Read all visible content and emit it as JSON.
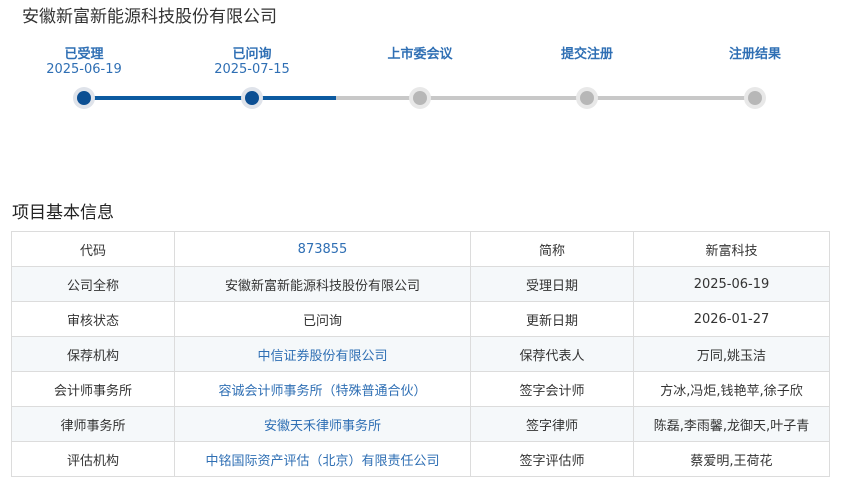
{
  "company_title": "安徽新富新能源科技股份有限公司",
  "progress": {
    "steps": [
      {
        "label": "已受理",
        "date": "2025-06-19",
        "status": "done"
      },
      {
        "label": "已问询",
        "date": "2025-07-15",
        "status": "done"
      },
      {
        "label": "上市委会议",
        "date": "",
        "status": "pending"
      },
      {
        "label": "提交注册",
        "date": "",
        "status": "pending"
      },
      {
        "label": "注册结果",
        "date": "",
        "status": "pending"
      }
    ],
    "colors": {
      "done": "#0c4f93",
      "pending": "#b7b7b7",
      "label": "#2f6fb4"
    }
  },
  "info_section": {
    "title": "项目基本信息",
    "rows": [
      {
        "l1": "代码",
        "v1": "873855",
        "v1_link": true,
        "l2": "简称",
        "v2": "新富科技"
      },
      {
        "l1": "公司全称",
        "v1": "安徽新富新能源科技股份有限公司",
        "v1_link": false,
        "l2": "受理日期",
        "v2": "2025-06-19"
      },
      {
        "l1": "审核状态",
        "v1": "已问询",
        "v1_link": false,
        "l2": "更新日期",
        "v2": "2026-01-27"
      },
      {
        "l1": "保荐机构",
        "v1": "中信证券股份有限公司",
        "v1_link": true,
        "l2": "保荐代表人",
        "v2": "万同,姚玉洁"
      },
      {
        "l1": "会计师事务所",
        "v1": "容诚会计师事务所（特殊普通合伙）",
        "v1_link": true,
        "l2": "签字会计师",
        "v2": "方冰,冯炬,钱艳苹,徐子欣"
      },
      {
        "l1": "律师事务所",
        "v1": "安徽天禾律师事务所",
        "v1_link": true,
        "l2": "签字律师",
        "v2": "陈磊,李雨馨,龙御天,叶子青"
      },
      {
        "l1": "评估机构",
        "v1": "中铭国际资产评估（北京）有限责任公司",
        "v1_link": true,
        "l2": "签字评估师",
        "v2": "蔡爱明,王荷花"
      }
    ]
  }
}
